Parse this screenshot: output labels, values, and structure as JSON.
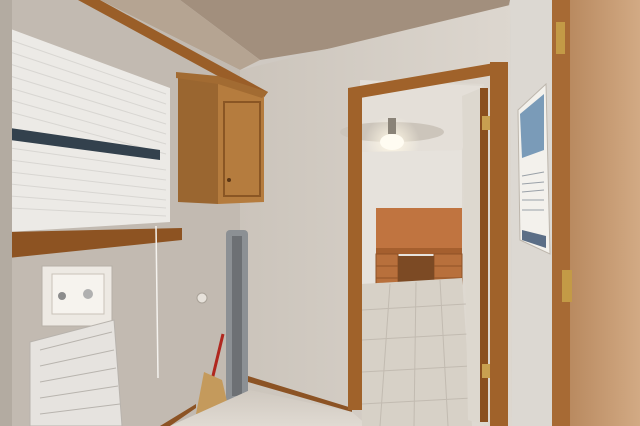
{
  "scene": {
    "type": "photo",
    "subject": "laundry-room",
    "colors": {
      "ceiling": "#9c8c7c",
      "wall": "#d9d3cc",
      "wall_shadow": "#c4bdb4",
      "wood": "#a0642c",
      "wood_dark": "#7a4518",
      "cabinet": "#b07a3a",
      "floor_tile": "#d6d0c8",
      "blind": "#f2f2f0",
      "door": "#c59a72",
      "heater": "#8a8e92"
    }
  },
  "poster": {
    "lines": []
  }
}
